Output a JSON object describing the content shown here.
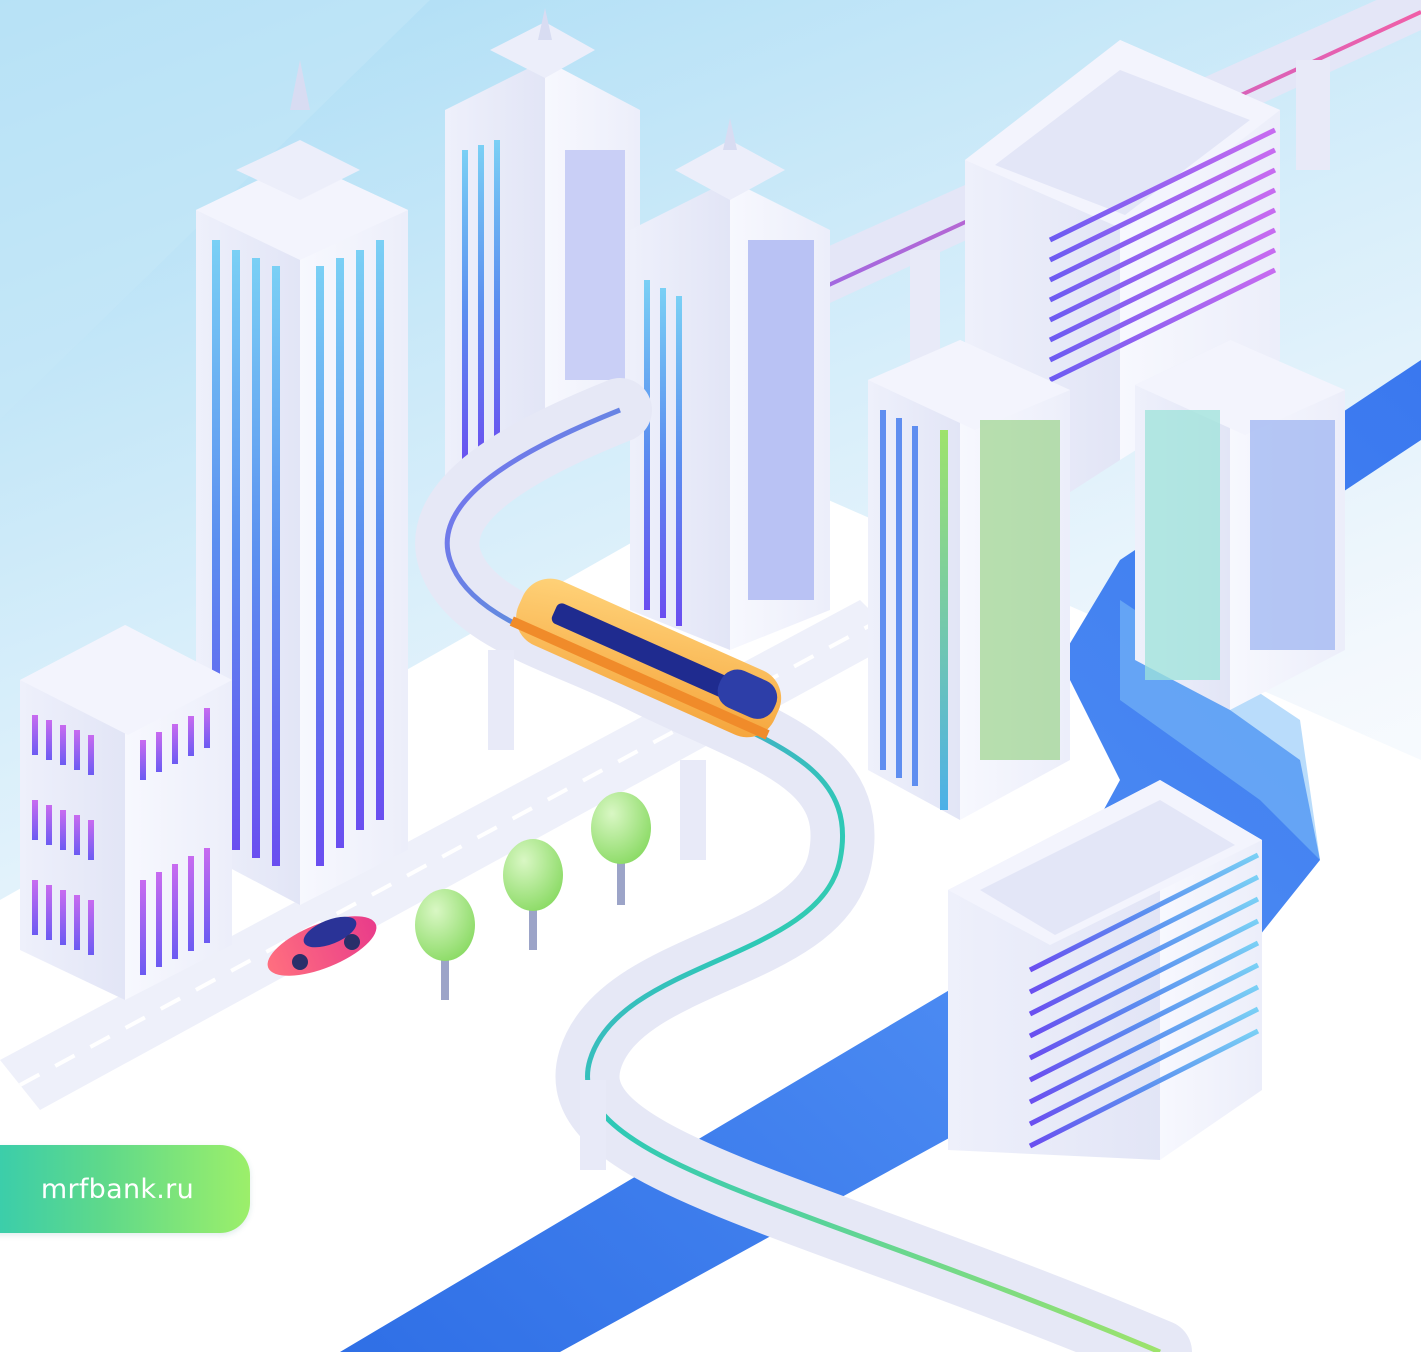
{
  "site_link": {
    "text": "mrfbank.ru"
  },
  "illustration": {
    "icon": "isometric-city-icon",
    "colors": {
      "sky": "#bfe4f7",
      "river": "#3f7ff0",
      "train": "#f8b64c",
      "car": "#f0506e",
      "trees": "#9be27a",
      "pill_start": "#2ec9b6",
      "pill_end": "#9cef6a"
    }
  }
}
